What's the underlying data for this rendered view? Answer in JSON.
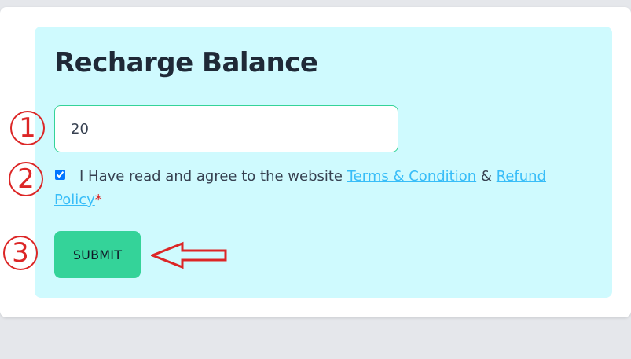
{
  "form": {
    "title": "Recharge Balance",
    "amount_value": "20",
    "agree": {
      "checked": true,
      "prefix": "I Have read and agree to the website",
      "terms_link": "Terms & Condition",
      "connector": "&",
      "refund_link": "Refund Policy",
      "required_mark": "*"
    },
    "submit_label": "SUBMIT"
  },
  "annotations": {
    "markers": [
      "1",
      "2",
      "3"
    ],
    "arrow_icon": "left-arrow-outline",
    "color": "#dc2626"
  },
  "colors": {
    "panel_background": "#cffafe",
    "button": "#34d399",
    "link": "#38bdf8",
    "page_background": "#e5e7eb"
  }
}
